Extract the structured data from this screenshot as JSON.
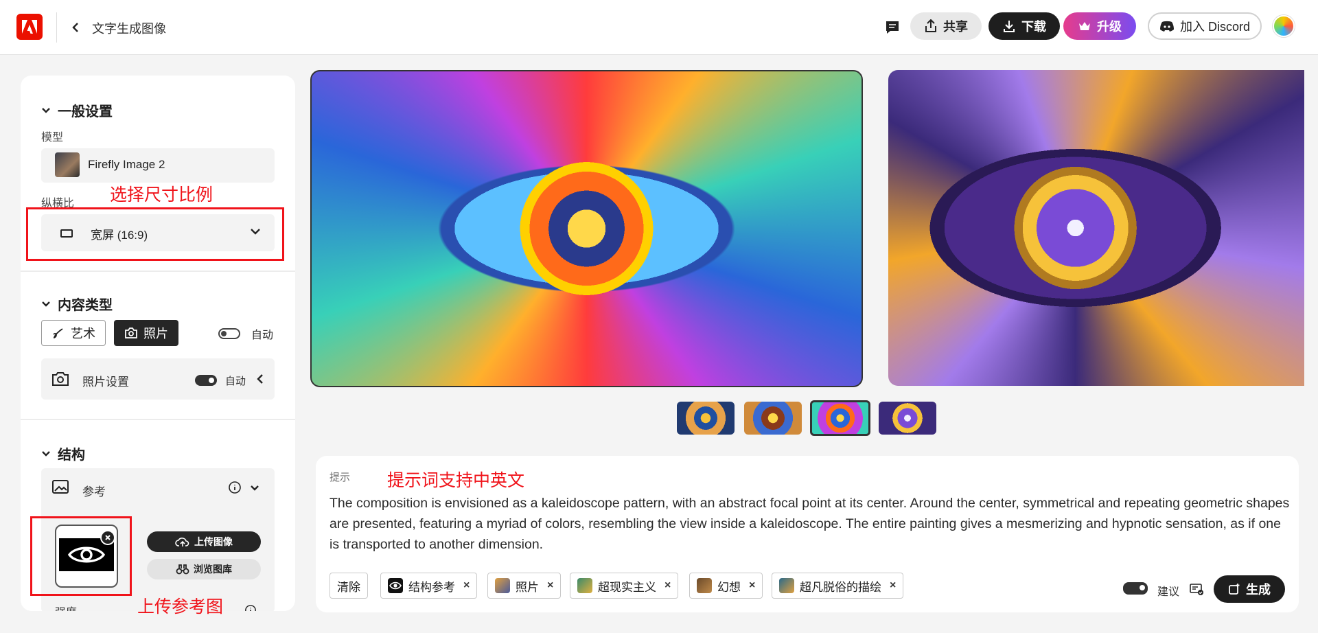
{
  "header": {
    "title": "文字生成图像",
    "share_label": "共享",
    "download_label": "下载",
    "upgrade_label": "升级",
    "discord_label": "加入 Discord"
  },
  "panel": {
    "general": {
      "heading": "一般设置",
      "model_label": "模型",
      "model_value": "Firefly Image 2",
      "aspect_label": "纵横比",
      "aspect_value": "宽屏 (16:9)"
    },
    "content_type": {
      "heading": "内容类型",
      "art_label": "艺术",
      "photo_label": "照片",
      "auto_label": "自动",
      "auto_on": false,
      "photo_settings_label": "照片设置",
      "photo_settings_auto_label": "自动",
      "photo_settings_auto_on": true
    },
    "structure": {
      "heading": "结构",
      "reference_label": "参考",
      "upload_label": "上传图像",
      "browse_label": "浏览图库",
      "strength_label": "强度"
    }
  },
  "annotations": {
    "aspect_note": "选择尺寸比例",
    "prompt_note": "提示词支持中英文",
    "upload_note": "上传参考图",
    "color": "#f0131a"
  },
  "gallery": {
    "thumbnail_count": 4,
    "selected_thumbnail_index": 3
  },
  "prompt": {
    "label": "提示",
    "text": "The composition is envisioned as a kaleidoscope pattern, with an abstract focal point at its center. Around the center, symmetrical and repeating geometric shapes are presented, featuring a myriad of colors, resembling the view inside a kaleidoscope. The entire painting gives a mesmerizing and hypnotic sensation, as if one is transported to another dimension.",
    "clear_label": "清除",
    "chips": [
      "结构参考",
      "照片",
      "超现实主义",
      "幻想",
      "超凡脱俗的描绘"
    ],
    "suggest_label": "建议",
    "suggest_on": true,
    "generate_label": "生成"
  },
  "colors": {
    "brand": "#eb1000",
    "dark": "#1e1e1e",
    "upgrade_gradient": [
      "#e63c8c",
      "#7a4cf0"
    ]
  }
}
